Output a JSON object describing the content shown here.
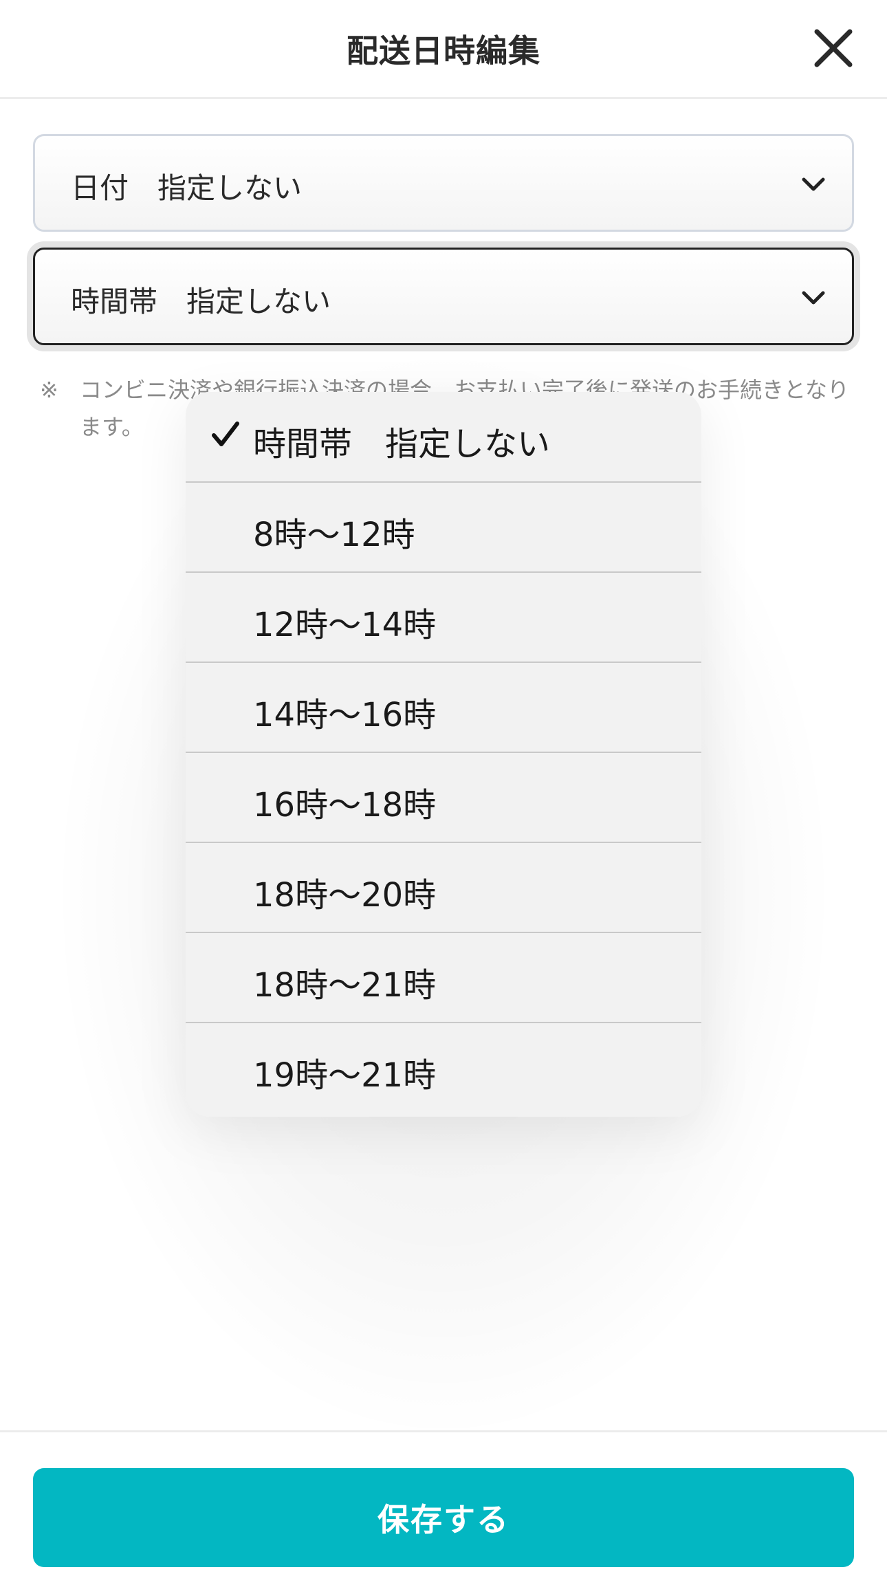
{
  "header": {
    "title": "配送日時編集",
    "close_icon": "close-icon"
  },
  "date_select": {
    "value": "日付　指定しない",
    "icon": "chevron-down-icon"
  },
  "time_select": {
    "value": "時間帯　指定しない",
    "icon": "chevron-down-icon"
  },
  "note": {
    "mark": "※",
    "text": "コンビニ決済や銀行振込決済の場合、お支払い完了後に発送のお手続きとなります。"
  },
  "dropdown": {
    "selected_index": 0,
    "options": [
      {
        "label": "時間帯　指定しない",
        "selected": true
      },
      {
        "label": "8時〜12時",
        "selected": false
      },
      {
        "label": "12時〜14時",
        "selected": false
      },
      {
        "label": "14時〜16時",
        "selected": false
      },
      {
        "label": "16時〜18時",
        "selected": false
      },
      {
        "label": "18時〜20時",
        "selected": false
      },
      {
        "label": "18時〜21時",
        "selected": false
      },
      {
        "label": "19時〜21時",
        "selected": false
      }
    ]
  },
  "footer": {
    "save_label": "保存する"
  },
  "colors": {
    "accent": "#03b7c2",
    "text": "#1a1a1a",
    "note": "#8a8a8a",
    "dropdown_bg": "#f2f2f2"
  }
}
